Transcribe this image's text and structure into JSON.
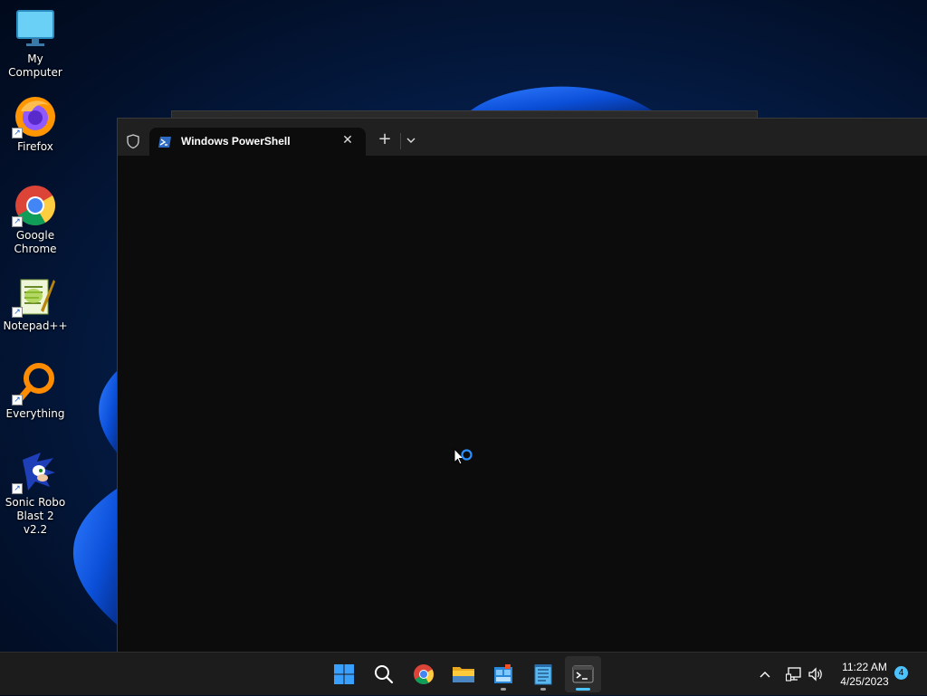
{
  "desktop": {
    "icons": [
      {
        "label": "My Computer",
        "icon": "monitor-icon"
      },
      {
        "label": "Firefox",
        "icon": "firefox-icon"
      },
      {
        "label": "Google Chrome",
        "icon": "chrome-icon"
      },
      {
        "label": "Notepad++",
        "icon": "notepadpp-icon"
      },
      {
        "label": "Everything",
        "icon": "search-magnifier-icon"
      },
      {
        "label": "Sonic Robo Blast 2 v2.2",
        "icon": "sonic-icon"
      }
    ]
  },
  "terminal": {
    "tab_title": "Windows PowerShell",
    "new_tab_label": "+",
    "close_label": "✕"
  },
  "taskbar": {
    "apps": [
      {
        "name": "start",
        "icon": "windows-logo-icon"
      },
      {
        "name": "search",
        "icon": "search-icon"
      },
      {
        "name": "chrome",
        "icon": "chrome-icon"
      },
      {
        "name": "file-explorer",
        "icon": "folder-icon"
      },
      {
        "name": "app",
        "icon": "app-icon"
      },
      {
        "name": "notepad",
        "icon": "notepad-icon"
      },
      {
        "name": "terminal",
        "icon": "terminal-icon",
        "active": true
      }
    ],
    "clock": {
      "time": "11:22 AM",
      "date": "4/25/2023"
    },
    "notification_count": "4"
  },
  "colors": {
    "accent": "#4cc2ff",
    "taskbar_bg": "#1c1c1c",
    "terminal_bg": "#0c0c0c"
  }
}
